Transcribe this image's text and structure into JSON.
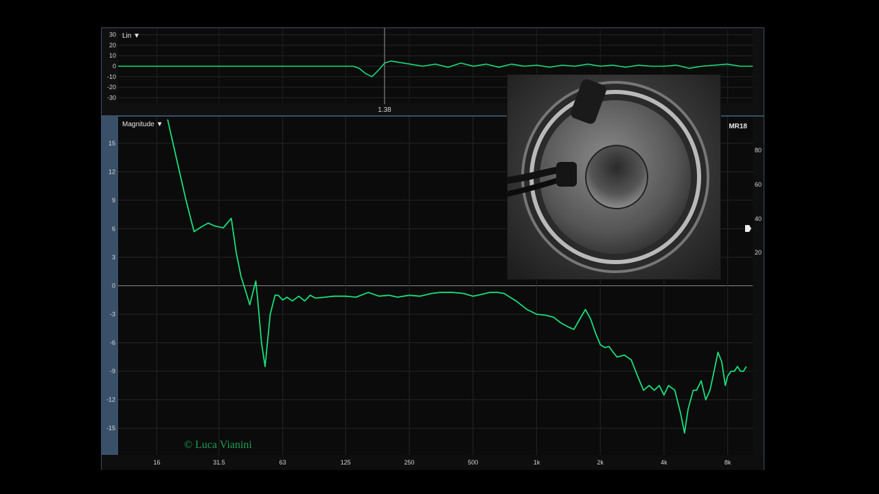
{
  "top_panel": {
    "mode_label": "Lin ▼",
    "y_ticks": [
      "30",
      "20",
      "10",
      "0",
      "-10",
      "-20",
      "-30"
    ],
    "cursor_label": "1.38"
  },
  "magnitude_panel": {
    "mode_label": "Magnitude ▼",
    "series_label": "MR18",
    "right_ticks": [
      "80",
      "60",
      "40",
      "20"
    ]
  },
  "watermark": "© Luca Vianini",
  "colors": {
    "trace": "#19e07a",
    "background": "#0b0b0b",
    "frame": "#3a5068",
    "grid": "#2a2a2a"
  },
  "chart_data": [
    {
      "type": "line",
      "title": "",
      "xlabel": "",
      "ylabel": "Lin",
      "ylim": [
        -35,
        35
      ],
      "cursor_x": 1.38,
      "cursor_label": "1.38",
      "grid": true,
      "series": [
        {
          "x": [
            0.0,
            0.1,
            0.2,
            0.3,
            0.37,
            0.38,
            0.39,
            0.4,
            0.41,
            0.42,
            0.43,
            0.44,
            0.46,
            0.48,
            0.5,
            0.52,
            0.54,
            0.56,
            0.58,
            0.6,
            0.62,
            0.64,
            0.66,
            0.68,
            0.7,
            0.72,
            0.74,
            0.76,
            0.78,
            0.8,
            0.82,
            0.84,
            0.86,
            0.88,
            0.9,
            0.92,
            0.94,
            0.96,
            0.98,
            1.0
          ],
          "values": [
            0,
            0,
            0,
            0,
            0,
            -2,
            -7,
            -10,
            -4,
            3,
            5,
            4,
            2,
            0,
            2,
            -1,
            3,
            0,
            2,
            -1,
            2,
            0,
            1,
            -1,
            1,
            0,
            2,
            0,
            1,
            -1,
            1,
            0,
            0,
            1,
            -2,
            0,
            1,
            2,
            0,
            0
          ]
        }
      ]
    },
    {
      "type": "line",
      "title": "",
      "xlabel": "",
      "ylabel": "Magnitude",
      "xscale": "log",
      "x_ticks": [
        "16",
        "31.5",
        "63",
        "125",
        "250",
        "500",
        "1k",
        "2k",
        "4k",
        "8k"
      ],
      "x_tick_values": [
        16,
        31.5,
        63,
        125,
        250,
        500,
        1000,
        2000,
        4000,
        8000
      ],
      "y_ticks": [
        "15",
        "12",
        "9",
        "6",
        "3",
        "0",
        "-3",
        "-6",
        "-9",
        "-12",
        "-15"
      ],
      "xlim": [
        10.5,
        10500
      ],
      "ylim": [
        -17.8,
        17.8
      ],
      "grid": true,
      "series": [
        {
          "name": "MR18",
          "x": [
            18,
            20,
            22,
            24,
            26,
            28,
            30,
            33,
            36,
            38,
            40,
            42,
            44,
            47,
            48,
            50,
            52,
            55,
            58,
            60,
            63,
            66,
            70,
            75,
            80,
            85,
            90,
            100,
            110,
            125,
            140,
            160,
            180,
            200,
            220,
            250,
            280,
            320,
            350,
            400,
            450,
            500,
            550,
            600,
            650,
            700,
            800,
            900,
            1000,
            1100,
            1200,
            1300,
            1400,
            1500,
            1600,
            1700,
            1800,
            1900,
            2000,
            2100,
            2200,
            2300,
            2400,
            2600,
            2800,
            3000,
            3200,
            3400,
            3600,
            3800,
            4000,
            4200,
            4500,
            4800,
            5000,
            5200,
            5500,
            5700,
            6000,
            6300,
            6600,
            6900,
            7200,
            7500,
            7800,
            8000,
            8300,
            8600,
            8900,
            9200,
            9500,
            9800
          ],
          "values": [
            17.5,
            13,
            9,
            5.7,
            6.2,
            6.6,
            6.3,
            6.1,
            7.1,
            3.5,
            1,
            -0.5,
            -2,
            0.5,
            -1.5,
            -6,
            -8.5,
            -3,
            -1,
            -1,
            -1.5,
            -1.2,
            -1.6,
            -1.1,
            -1.6,
            -1,
            -1.3,
            -1.2,
            -1.1,
            -1.1,
            -1.2,
            -0.7,
            -1.1,
            -1,
            -1.2,
            -1,
            -1.1,
            -0.8,
            -0.7,
            -0.7,
            -0.8,
            -1.1,
            -0.9,
            -0.7,
            -0.7,
            -0.8,
            -1.6,
            -2.5,
            -3,
            -3.1,
            -3.3,
            -3.9,
            -4.3,
            -4.6,
            -3.5,
            -2.5,
            -3.5,
            -5,
            -6.2,
            -6.5,
            -6.4,
            -7,
            -7.5,
            -7.3,
            -7.8,
            -9.5,
            -11,
            -10.5,
            -11,
            -10.5,
            -11.5,
            -10.5,
            -11,
            -13.5,
            -15.5,
            -13,
            -11,
            -11,
            -10,
            -12,
            -11,
            -9,
            -7,
            -8,
            -10.5,
            -9.5,
            -9,
            -9,
            -8.5,
            -9,
            -9,
            -8.5
          ]
        }
      ]
    }
  ]
}
